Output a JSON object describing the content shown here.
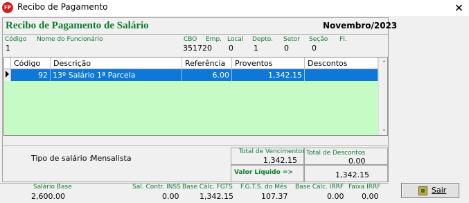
{
  "window": {
    "icon_text": "FP",
    "title": "Recibo de Pagamento",
    "close_glyph": "✕"
  },
  "header": {
    "title": "Recibo de Pagamento de Salário",
    "periodo": "Novembro/2023"
  },
  "employee": {
    "codigo_label": "Código",
    "codigo": "1",
    "nome_label": "Nome do Funcionário",
    "nome": "",
    "cbo_label": "CBO",
    "cbo": "351720",
    "emp_label": "Emp.",
    "emp": "0",
    "local_label": "Local",
    "local": "1",
    "depto_label": "Depto.",
    "depto": "0",
    "setor_label": "Setor",
    "setor": "0",
    "secao_label": "Seção",
    "secao": "",
    "fl_label": "Fl.",
    "fl": ""
  },
  "grid": {
    "columns": [
      "Código",
      "Descrição",
      "Referência",
      "Proventos",
      "Descontos"
    ],
    "rows": [
      {
        "codigo": "92",
        "descricao": "13º Salário 1ª Parcela",
        "referencia": "6.00",
        "proventos": "1,342.15",
        "descontos": ""
      }
    ],
    "scroll_up": "⌃",
    "scroll_down": "⌄"
  },
  "summary": {
    "tipo_label": "Tipo de salário :",
    "tipo_value": "Mensalista",
    "total_venc_label": "Total de Vencimentos",
    "total_venc": "1,342.15",
    "total_desc_label": "Total de Descontos",
    "total_desc": "0.00",
    "liquido_label": "Valor Líquido  =>",
    "liquido": "1,342.15"
  },
  "bases": {
    "salario_base_label": "Salário Base",
    "salario_base": "2,600.00",
    "inss_label": "Sal. Contr. INSS",
    "inss": "0.00",
    "fgts_base_label": "Base Cálc. FGTS",
    "fgts_base": "1,342.15",
    "fgts_mes_label": "F.G.T.S. do Mês",
    "fgts_mes": "107.37",
    "irrf_base_label": "Base Cálc. IRRF",
    "irrf_base": "0.00",
    "faixa_irrf_label": "Faixa IRRF",
    "faixa_irrf": "0.00"
  },
  "buttons": {
    "sair": "Sair"
  },
  "colors": {
    "green_label": "#0f7a30",
    "selection": "#0d78d7",
    "grid_bg": "#c6fbc6"
  }
}
